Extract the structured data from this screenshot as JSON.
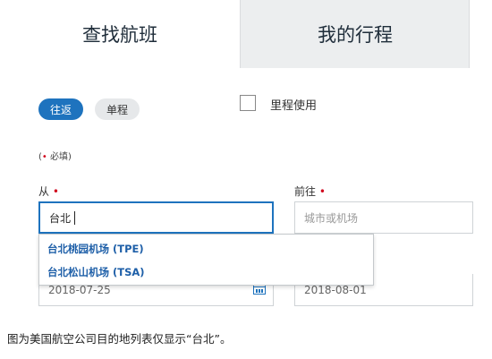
{
  "tabs": {
    "find_flights": "查找航班",
    "my_trips": "我的行程"
  },
  "trip_type": {
    "round_trip": "往返",
    "one_way": "单程",
    "selected": "往返"
  },
  "miles": {
    "label": "里程使用",
    "checked": false
  },
  "required_note": {
    "open": "(",
    "marker": "•",
    "text": " 必填)"
  },
  "from": {
    "label": "从",
    "marker": "•",
    "value": "台北"
  },
  "to": {
    "label": "前往",
    "marker": "•",
    "placeholder": "城市或机场"
  },
  "suggestions": [
    "台北桃园机场 (TPE)",
    "台北松山机场 (TSA)"
  ],
  "dates": {
    "depart": "2018-07-25",
    "return": "2018-08-01"
  },
  "caption": "图为美国航空公司目的地列表仅显示“台北”。",
  "colors": {
    "accent": "#1e73be",
    "required": "#d0021b",
    "inactive_tab": "#eceeef"
  }
}
